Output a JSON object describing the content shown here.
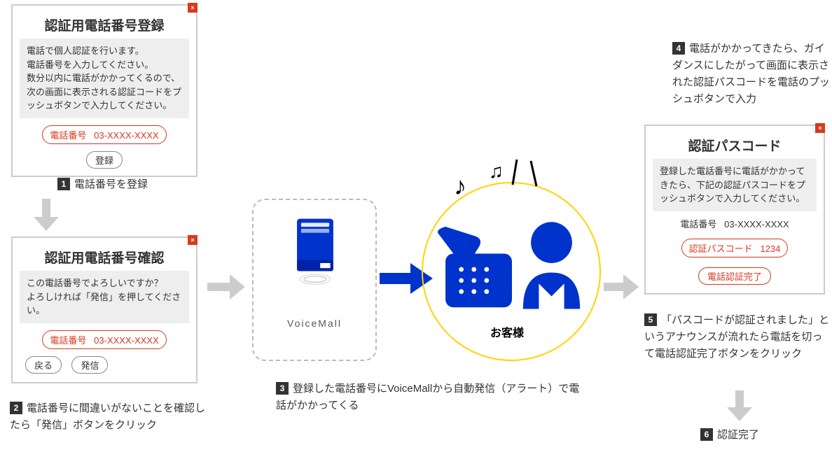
{
  "box1": {
    "title": "認証用電話番号登録",
    "desc": "電話で個人認証を行います。\n電話番号を入力してください。\n数分以内に電話がかかってくるので、次の画面に表示される認証コードをプッシュボタンで入力してください。",
    "phone_label": "電話番号",
    "phone_value": "03-XXXX-XXXX",
    "register_btn": "登録"
  },
  "step1": "電話番号を登録",
  "box2": {
    "title": "認証用電話番号確認",
    "desc": "この電話番号でよろしいですか？\nよろしければ「発信」を押してください。",
    "phone_label": "電話番号",
    "phone_value": "03-XXXX-XXXX",
    "back_btn": "戻る",
    "send_btn": "発信"
  },
  "step2": "電話番号に間違いがないことを確認したら「発信」ボタンをクリック",
  "voicemall_label": "VoiceMall",
  "customer_label": "お客様",
  "step3": "登録した電話番号にVoiceMallから自動発信（アラート）で電話がかかってくる",
  "step4": "電話がかかってきたら、ガイダンスにしたがって画面に表示された認証パスコードを電話のプッシュボタンで入力",
  "box3": {
    "title": "認証パスコード",
    "desc": "登録した電話番号に電話がかかってきたら、下記の認証パスコードをプッシュボタンで入力してください。",
    "phone_label": "電話番号",
    "phone_value": "03-XXXX-XXXX",
    "code_label": "認証パスコード",
    "code_value": "1234",
    "done_btn": "電話認証完了"
  },
  "step5": "「パスコードが認証されました」というアナウンスが流れたら電話を切って電話認証完了ボタンをクリック",
  "step6": "認証完了"
}
